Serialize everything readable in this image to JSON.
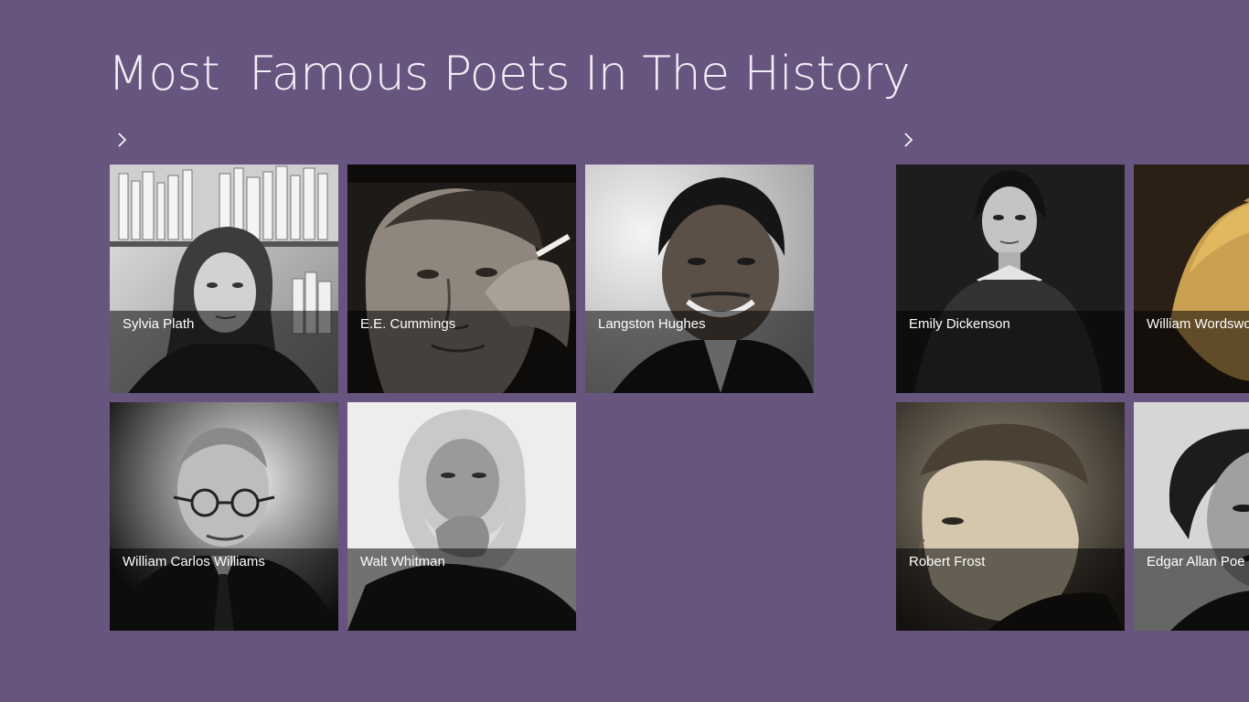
{
  "app": {
    "title": "Most  Famous Poets In The History"
  },
  "groups": [
    {
      "chevron_icon": "chevron-right-icon",
      "tiles": [
        {
          "name": "Sylvia Plath"
        },
        {
          "name": "E.E. Cummings"
        },
        {
          "name": "Langston Hughes"
        },
        {
          "name": "William Carlos Williams"
        },
        {
          "name": "Walt Whitman"
        }
      ]
    },
    {
      "chevron_icon": "chevron-right-icon",
      "tiles": [
        {
          "name": "Emily Dickenson"
        },
        {
          "name": "William Wordsworth"
        },
        {
          "name": "Robert Frost"
        },
        {
          "name": "Edgar Allan Poe"
        }
      ]
    }
  ],
  "colors": {
    "background": "#67557f",
    "title": "#f1eef5",
    "overlay": "rgba(0,0,0,0.52)",
    "label": "#ffffff"
  }
}
